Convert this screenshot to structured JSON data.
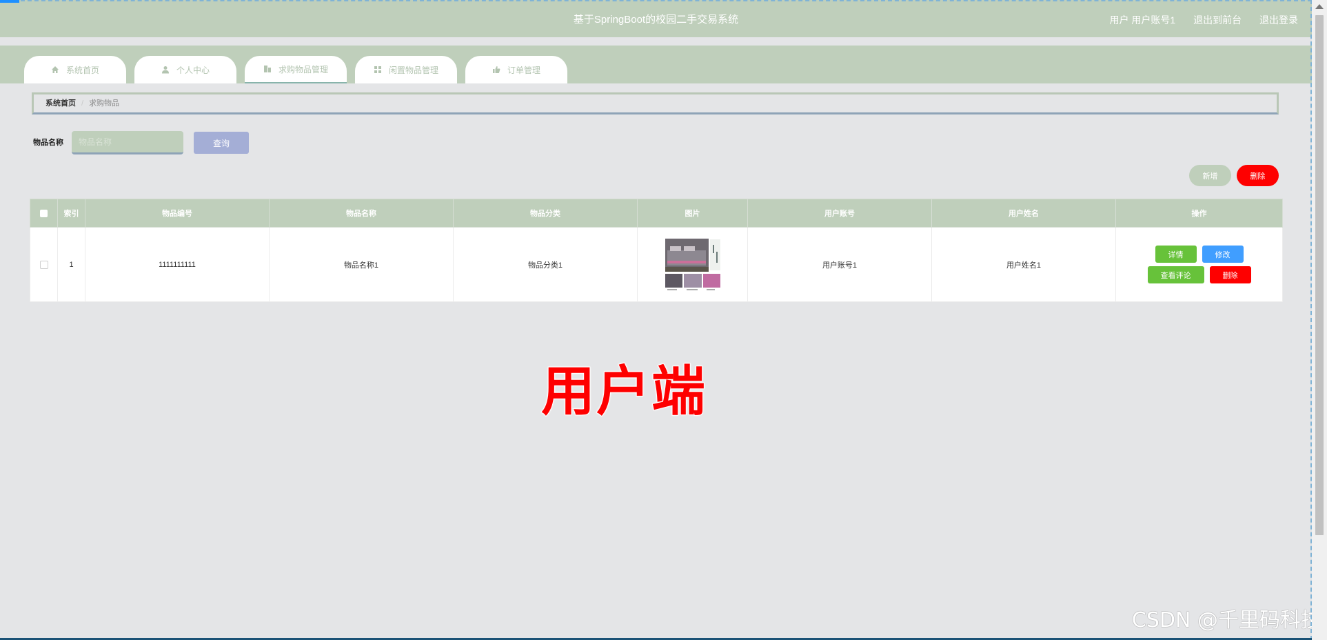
{
  "header": {
    "title": "基于SpringBoot的校园二手交易系统",
    "user": "用户 用户账号1",
    "back_to_front": "退出到前台",
    "logout": "退出登录"
  },
  "nav": {
    "tabs": [
      {
        "label": "系统首页",
        "icon": "home-icon"
      },
      {
        "label": "个人中心",
        "icon": "user-icon"
      },
      {
        "label": "求购物品管理",
        "icon": "building-icon"
      },
      {
        "label": "闲置物品管理",
        "icon": "grid-icon"
      },
      {
        "label": "订单管理",
        "icon": "thumbs-up-icon"
      }
    ],
    "active_index": 2
  },
  "breadcrumb": {
    "home": "系统首页",
    "separator": "/",
    "current": "求购物品"
  },
  "search": {
    "label": "物品名称",
    "placeholder": "物品名称",
    "value": "",
    "query_button": "查询"
  },
  "actions": {
    "add": "新增",
    "delete": "删除"
  },
  "table": {
    "columns": [
      "索引",
      "物品编号",
      "物品名称",
      "物品分类",
      "图片",
      "用户账号",
      "用户姓名",
      "操作"
    ],
    "rows": [
      {
        "index": "1",
        "item_no": "1111111111",
        "item_name": "物品名称1",
        "category": "物品分类1",
        "image": "bedding-photo",
        "account": "用户账号1",
        "username": "用户姓名1"
      }
    ],
    "row_actions": {
      "detail": "详情",
      "edit": "修改",
      "view_comments": "查看评论",
      "delete": "删除"
    }
  },
  "overlay": {
    "caption": "用户端",
    "watermark": "CSDN @千里码科技"
  },
  "colors": {
    "theme_green": "#bfcfbb",
    "background": "#e4e5e7",
    "query_blue": "#a4aed6",
    "danger_red": "#fe0000",
    "success_green": "#67c23a",
    "primary_blue": "#409eff"
  }
}
